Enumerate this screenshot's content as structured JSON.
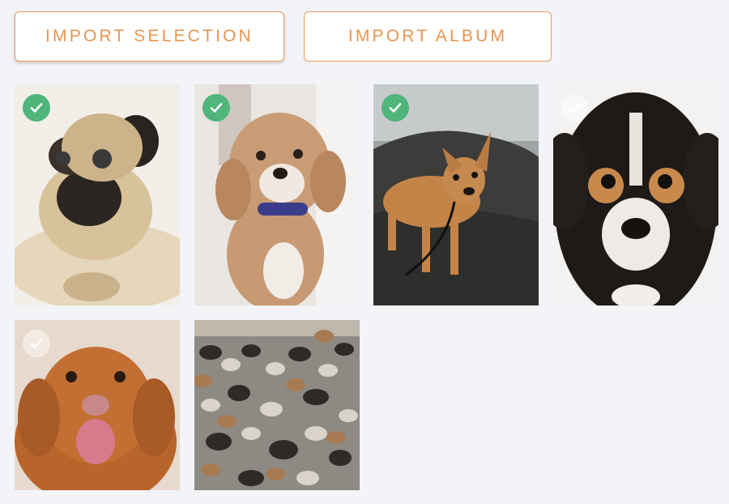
{
  "toolbar": {
    "import_selection_label": "IMPORT SELECTION",
    "import_album_label": "IMPORT ALBUM"
  },
  "colors": {
    "accent": "#e8954f",
    "check_selected": "#4fb57a",
    "background": "#f3f4f8"
  },
  "photos": [
    {
      "subject": "pug lying down",
      "selected": true
    },
    {
      "subject": "curly brown dog with blue collar",
      "selected": true
    },
    {
      "subject": "tan chihuahua mix on rock",
      "selected": true
    },
    {
      "subject": "tricolor puppy close-up",
      "selected": false
    },
    {
      "subject": "ginger retriever with tongue out",
      "selected": false
    },
    {
      "subject": "large group of dogs",
      "selected": false
    }
  ]
}
